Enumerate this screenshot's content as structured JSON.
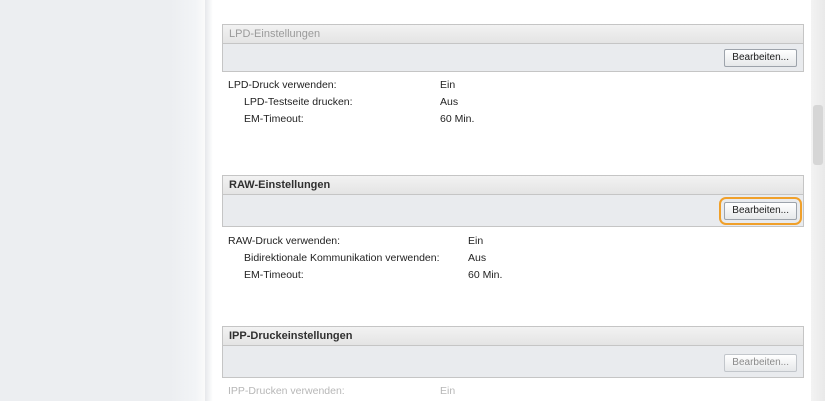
{
  "sections": {
    "lpd": {
      "title": "LPD-Einstellungen",
      "edit_label": "Bearbeiten...",
      "rows": [
        {
          "label": "LPD-Druck verwenden:",
          "value": "Ein"
        },
        {
          "label": "LPD-Testseite drucken:",
          "value": "Aus"
        },
        {
          "label": "EM-Timeout:",
          "value": "60 Min."
        }
      ]
    },
    "raw": {
      "title": "RAW-Einstellungen",
      "edit_label": "Bearbeiten...",
      "rows": [
        {
          "label": "RAW-Druck verwenden:",
          "value": "Ein"
        },
        {
          "label": "Bidirektionale Kommunikation verwenden:",
          "value": "Aus"
        },
        {
          "label": "EM-Timeout:",
          "value": "60 Min."
        }
      ]
    },
    "ipp": {
      "title": "IPP-Druckeinstellungen",
      "edit_label": "Bearbeiten...",
      "rows": [
        {
          "label": "IPP-Drucken verwenden:",
          "value": "Ein"
        }
      ]
    }
  },
  "highlight_color": "#f0a02a"
}
